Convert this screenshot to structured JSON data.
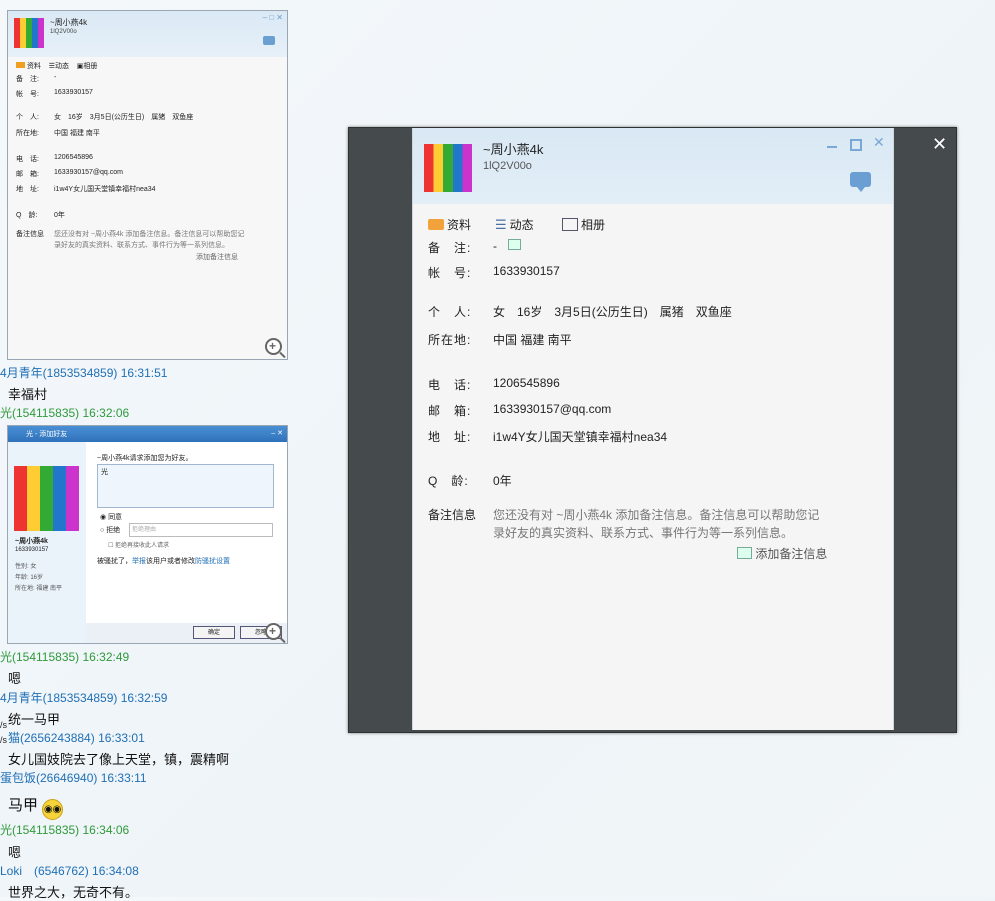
{
  "profile": {
    "name": "~周小燕4k",
    "sub": "1lQ2V00o",
    "tabs": [
      "资料",
      "动态",
      "相册"
    ],
    "fields": [
      {
        "label": "备　注:",
        "value": "-"
      },
      {
        "label": "帐　号:",
        "value": "1633930157"
      },
      {
        "label": "个　人:",
        "value": "女　16岁　3月5日(公历生日)　属猪　双鱼座"
      },
      {
        "label": "所在地:",
        "value": "中国 福建 南平"
      },
      {
        "label": "电　话:",
        "value": "1206545896"
      },
      {
        "label": "邮　箱:",
        "value": "1633930157@qq.com"
      },
      {
        "label": "地　址:",
        "value": "i1w4Y女儿国天堂镇幸福村nea34"
      },
      {
        "label": "Q　龄:",
        "value": "0年"
      }
    ],
    "note_label": "备注信息",
    "note_text_1": "您还没有对 ~周小燕4k 添加备注信息。备注信息可以帮助您记",
    "note_text_2": "录好友的真实资料、联系方式、事件行为等一系列信息。",
    "add_note": "添加备注信息"
  },
  "friend_dialog": {
    "title": "光 - 添加好友",
    "request_text": "~周小燕4k请求添加您为好友。",
    "message": "光",
    "name": "~周小燕4k",
    "account": "1633930157",
    "gender": "性别: 女",
    "age": "年龄: 16岁",
    "location": "所在地: 福建 南平",
    "accept": "同意",
    "reject": "拒绝",
    "reason_placeholder": "拒绝理由",
    "block": "拒绝再接收此人请求",
    "harass_prefix": "被骚扰了，",
    "report": "举报",
    "harass_mid": "该用户或者修改",
    "harass_link": "防骚扰设置",
    "ok": "确定",
    "ignore": "忽略"
  },
  "chat": {
    "sender_1": "4月青年(1853534859) 16:31:51",
    "msg_1": "幸福村",
    "sender_2": "光(154115835) 16:32:06",
    "sender_3": "光(154115835) 16:32:49",
    "msg_3": "嗯",
    "sender_4": "4月青年(1853534859) 16:32:59",
    "msg_4": "统一马甲",
    "sender_5": "猫(2656243884) 16:33:01",
    "msg_5": "女儿国妓院去了像上天堂，镇，震精啊",
    "sender_6": "蛋包饭(26646940) 16:33:11",
    "msg_6": "马甲",
    "sender_7": "光(154115835) 16:34:06",
    "msg_7": "嗯",
    "sender_8": "Loki　(6546762) 16:34:08",
    "msg_8": "世界之大，无奇不有。",
    "side_1": "/s",
    "side_2": "/s"
  },
  "colors": {
    "blue_name": "#1f6fb5",
    "green_name": "#2f9a3a",
    "viewer_bg": "#454a4c"
  }
}
